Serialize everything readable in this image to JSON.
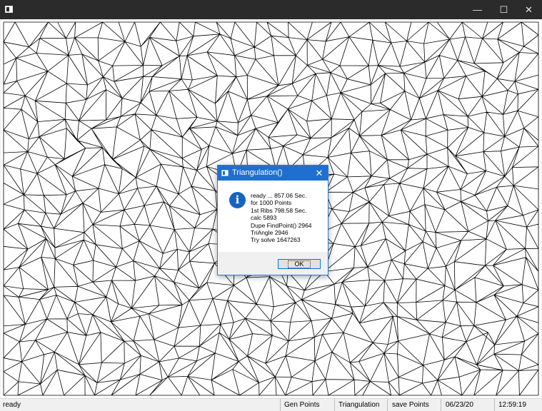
{
  "window": {
    "title": "",
    "controls": {
      "minimize": "—",
      "maximize": "☐",
      "close": "✕"
    }
  },
  "canvas": {
    "line_color": "#000000",
    "background": "#ffffff"
  },
  "statusbar": {
    "status": "ready",
    "gen_points": "Gen Points",
    "triangulation": "Triangulation",
    "save_points": "save Points",
    "date": "06/23/20",
    "time": "12:59:19"
  },
  "dialog": {
    "title": "Triangulation()",
    "close": "✕",
    "icon": "information-icon",
    "lines": [
      "ready ... 857.06 Sec.",
      "for 1000 Points",
      "1st Ribs 798.58 Sec.",
      "calc 5893",
      "Dupe FindPoint() 2964",
      "TriAngle 2946",
      "Try solve 1647263"
    ],
    "ok_label": "OK",
    "accent": "#1e6fd0"
  }
}
